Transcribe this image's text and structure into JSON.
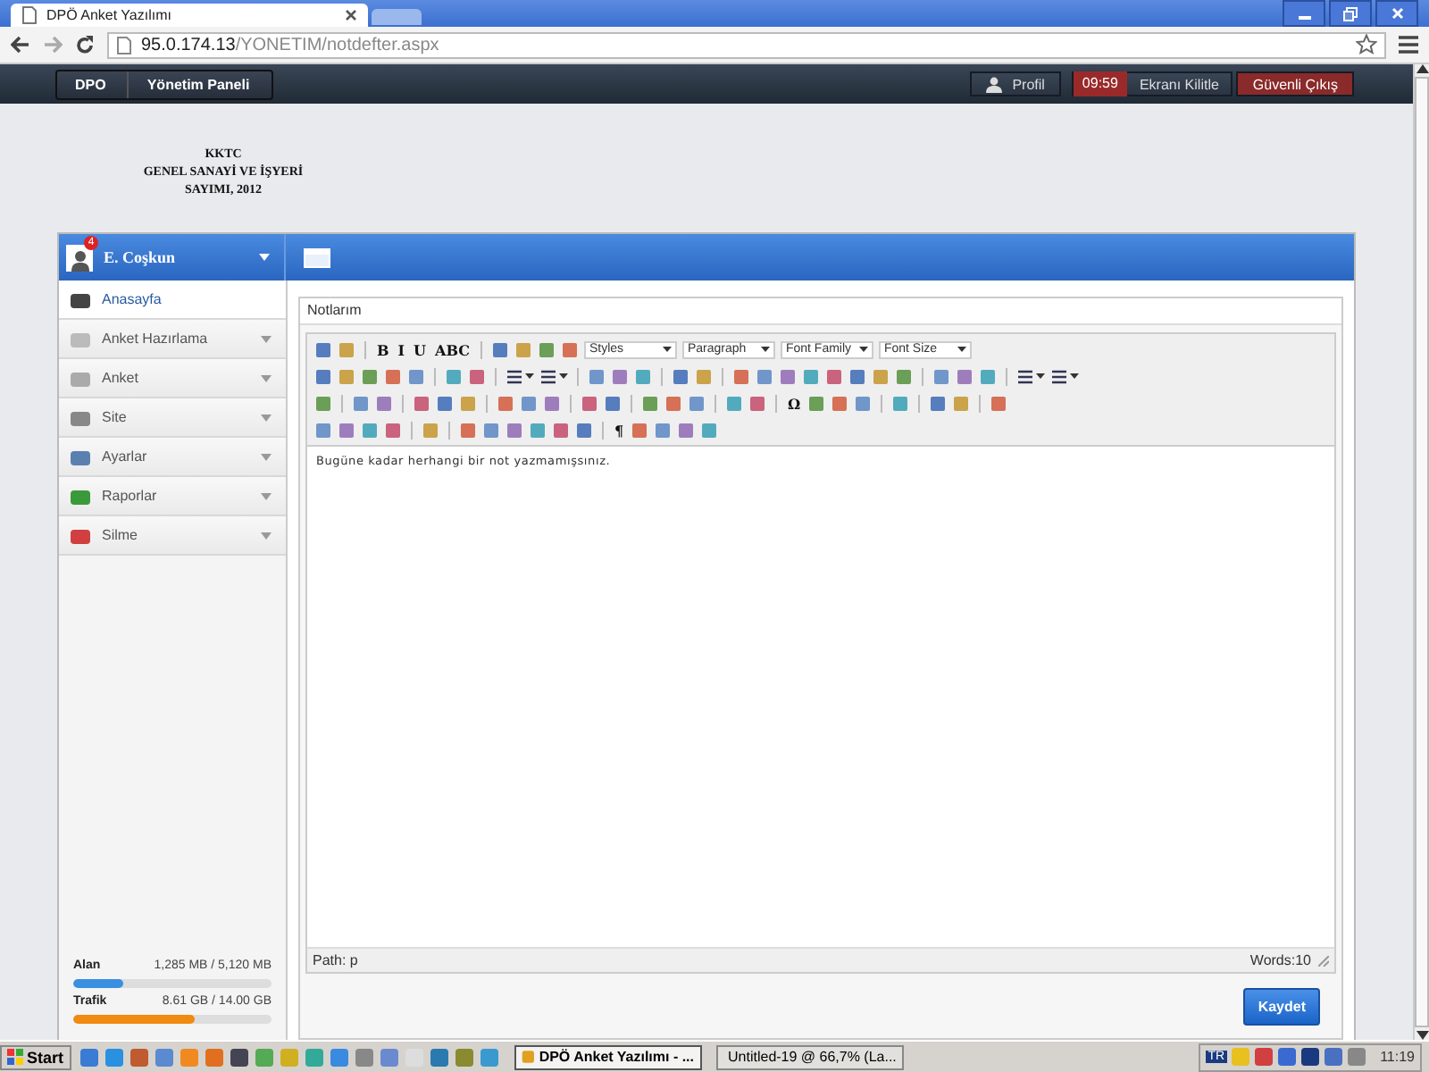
{
  "browser": {
    "tab_title": "DPÖ Anket Yazılımı",
    "url_host": "95.0.174.13",
    "url_path": "/YONETIM/notdefter.aspx"
  },
  "navbar": {
    "breadcrumbs": [
      "DPO",
      "Yönetim Paneli"
    ],
    "profile": "Profil",
    "timer": "09:59",
    "lock": "Ekranı Kilitle",
    "logout": "Güvenli Çıkış"
  },
  "header_lines": [
    "KKTC",
    "GENEL SANAYİ VE İŞYERİ",
    "SAYIMI, 2012"
  ],
  "user": {
    "name": "E. Coşkun",
    "badge": "4"
  },
  "sidebar": {
    "items": [
      {
        "label": "Anasayfa",
        "selected": true,
        "expandable": false
      },
      {
        "label": "Anket Hazırlama",
        "selected": false,
        "expandable": true
      },
      {
        "label": "Anket",
        "selected": false,
        "expandable": true
      },
      {
        "label": "Site",
        "selected": false,
        "expandable": true
      },
      {
        "label": "Ayarlar",
        "selected": false,
        "expandable": true
      },
      {
        "label": "Raporlar",
        "selected": false,
        "expandable": true
      },
      {
        "label": "Silme",
        "selected": false,
        "expandable": true
      }
    ]
  },
  "usage": [
    {
      "label": "Alan",
      "reading": "1,285 MB / 5,120 MB",
      "level": 0.25,
      "color": "#3b8fe0"
    },
    {
      "label": "Trafik",
      "reading": "8.61 GB / 14.00 GB",
      "level": 0.615,
      "color": "#f08a10"
    }
  ],
  "editor": {
    "title": "Notlarım",
    "toolbar_rows": [
      [
        {
          "kind": "icon"
        },
        {
          "kind": "icon"
        },
        {
          "kind": "sep"
        },
        {
          "kind": "glyph",
          "label": "B"
        },
        {
          "kind": "glyph",
          "label": "I"
        },
        {
          "kind": "glyph",
          "label": "U"
        },
        {
          "kind": "glyph",
          "label": "ABC"
        },
        {
          "kind": "sep"
        },
        {
          "kind": "icon"
        },
        {
          "kind": "icon"
        },
        {
          "kind": "icon"
        },
        {
          "kind": "icon"
        },
        {
          "kind": "select",
          "label": "Styles"
        },
        {
          "kind": "select",
          "label": "Paragraph"
        },
        {
          "kind": "select",
          "label": "Font Family"
        },
        {
          "kind": "select",
          "label": "Font Size"
        }
      ],
      [
        {
          "kind": "icon"
        },
        {
          "kind": "icon"
        },
        {
          "kind": "icon"
        },
        {
          "kind": "icon"
        },
        {
          "kind": "icon"
        },
        {
          "kind": "sep"
        },
        {
          "kind": "icon"
        },
        {
          "kind": "icon"
        },
        {
          "kind": "sep"
        },
        {
          "kind": "split"
        },
        {
          "kind": "split"
        },
        {
          "kind": "sep"
        },
        {
          "kind": "icon"
        },
        {
          "kind": "icon"
        },
        {
          "kind": "icon"
        },
        {
          "kind": "sep"
        },
        {
          "kind": "icon"
        },
        {
          "kind": "icon"
        },
        {
          "kind": "sep"
        },
        {
          "kind": "icon"
        },
        {
          "kind": "icon"
        },
        {
          "kind": "icon"
        },
        {
          "kind": "icon"
        },
        {
          "kind": "icon"
        },
        {
          "kind": "icon"
        },
        {
          "kind": "icon"
        },
        {
          "kind": "icon"
        },
        {
          "kind": "sep"
        },
        {
          "kind": "icon"
        },
        {
          "kind": "icon"
        },
        {
          "kind": "icon"
        },
        {
          "kind": "sep"
        },
        {
          "kind": "split"
        },
        {
          "kind": "split"
        }
      ],
      [
        {
          "kind": "icon"
        },
        {
          "kind": "sep"
        },
        {
          "kind": "icon"
        },
        {
          "kind": "icon"
        },
        {
          "kind": "sep"
        },
        {
          "kind": "icon"
        },
        {
          "kind": "icon"
        },
        {
          "kind": "icon"
        },
        {
          "kind": "sep"
        },
        {
          "kind": "icon"
        },
        {
          "kind": "icon"
        },
        {
          "kind": "icon"
        },
        {
          "kind": "sep"
        },
        {
          "kind": "icon"
        },
        {
          "kind": "icon"
        },
        {
          "kind": "sep"
        },
        {
          "kind": "icon"
        },
        {
          "kind": "icon"
        },
        {
          "kind": "icon"
        },
        {
          "kind": "sep"
        },
        {
          "kind": "icon"
        },
        {
          "kind": "icon"
        },
        {
          "kind": "sep"
        },
        {
          "kind": "glyph",
          "label": "Ω"
        },
        {
          "kind": "icon"
        },
        {
          "kind": "icon"
        },
        {
          "kind": "icon"
        },
        {
          "kind": "sep"
        },
        {
          "kind": "icon"
        },
        {
          "kind": "sep"
        },
        {
          "kind": "icon"
        },
        {
          "kind": "icon"
        },
        {
          "kind": "sep"
        },
        {
          "kind": "icon"
        }
      ],
      [
        {
          "kind": "icon"
        },
        {
          "kind": "icon"
        },
        {
          "kind": "icon"
        },
        {
          "kind": "icon"
        },
        {
          "kind": "sep"
        },
        {
          "kind": "icon"
        },
        {
          "kind": "sep"
        },
        {
          "kind": "icon"
        },
        {
          "kind": "icon"
        },
        {
          "kind": "icon"
        },
        {
          "kind": "icon"
        },
        {
          "kind": "icon"
        },
        {
          "kind": "icon"
        },
        {
          "kind": "sep"
        },
        {
          "kind": "glyph",
          "label": "¶"
        },
        {
          "kind": "icon"
        },
        {
          "kind": "icon"
        },
        {
          "kind": "icon"
        },
        {
          "kind": "icon"
        }
      ]
    ],
    "content": "Bugüne kadar herhangi bir not yazmamışsınız.",
    "path": "Path: p",
    "words": "Words:10",
    "save": "Kaydet"
  },
  "taskbar": {
    "start": "Start",
    "tasks": [
      {
        "label": "DPÖ Anket Yazılımı - ...",
        "selected": true
      },
      {
        "label": "Untitled-19 @ 66,7% (La...",
        "selected": false
      }
    ],
    "language": "TR",
    "clock": "11:19"
  }
}
